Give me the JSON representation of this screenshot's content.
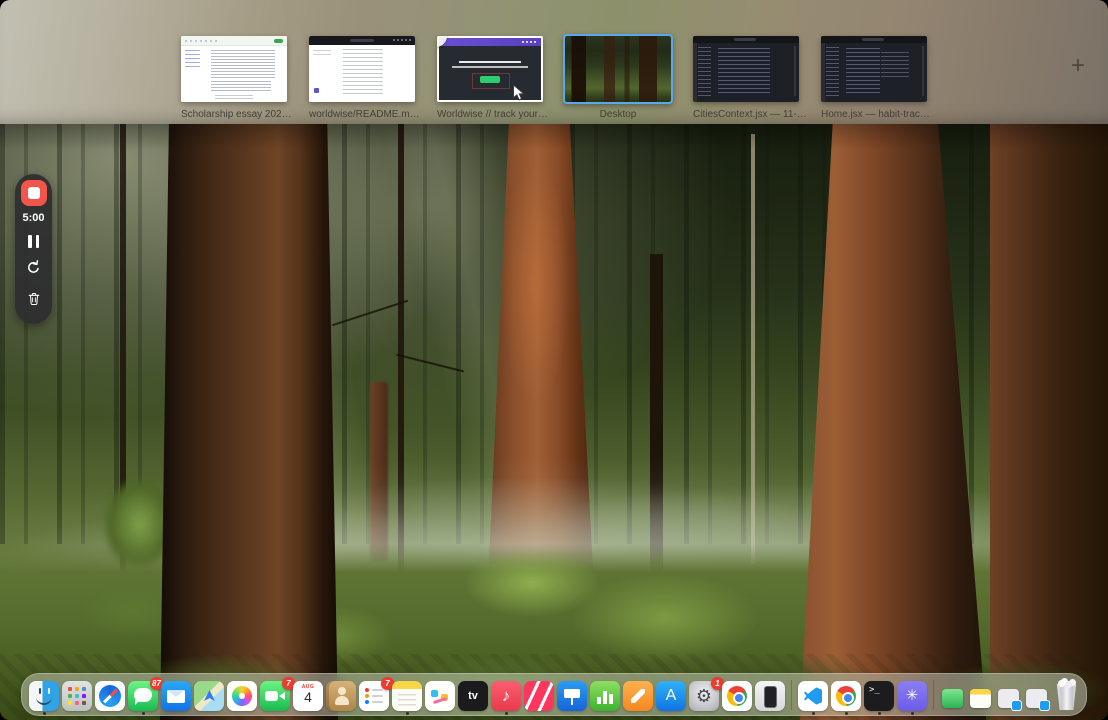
{
  "mission_control": {
    "add_desktop": "+",
    "spaces": [
      {
        "label": "Scholarship essay 202…",
        "type": "document-window"
      },
      {
        "label": "worldwise/README.m…",
        "type": "browser-window"
      },
      {
        "label": "Worldwise // track your…",
        "type": "browser-window"
      },
      {
        "label": "Desktop",
        "type": "desktop",
        "selected": true
      },
      {
        "label": "CitiesContext.jsx — 11-…",
        "type": "code-editor-window"
      },
      {
        "label": "Home.jsx — habit-trac…",
        "type": "code-editor-window"
      }
    ]
  },
  "recorder": {
    "timer": "5:00"
  },
  "dock": {
    "calendar": {
      "month": "AUG",
      "day": "4"
    },
    "badges": {
      "messages": "87",
      "facetime": "7",
      "reminders": "7",
      "settings": "1"
    },
    "glyphs": {
      "tv": "tv",
      "appstore": "A",
      "terminal": ">_",
      "music": "♪",
      "settings_gear": "⚙",
      "screen_studio": "✳"
    },
    "icons": [
      "finder-icon",
      "launchpad-icon",
      "safari-icon",
      "messages-icon",
      "mail-icon",
      "maps-icon",
      "photos-icon",
      "facetime-icon",
      "calendar-icon",
      "contacts-icon",
      "reminders-icon",
      "notes-icon",
      "freeform-icon",
      "apple-tv-icon",
      "music-icon",
      "news-icon",
      "keynote-icon",
      "numbers-icon",
      "pages-icon",
      "app-store-icon",
      "system-settings-icon",
      "chrome-icon",
      "iphone-mirroring-icon",
      "vscode-icon",
      "chrome-icon",
      "terminal-icon",
      "screen-studio-icon",
      "minimized-green-window",
      "minimized-notes-window",
      "minimized-vscode-window",
      "minimized-vscode-window",
      "trash-icon"
    ]
  },
  "colors": {
    "selection_blue": "#5aa7ef",
    "badge_red": "#ec3b2f",
    "record_red": "#f2564a",
    "dock_bg": "rgba(198,202,188,0.52)"
  }
}
